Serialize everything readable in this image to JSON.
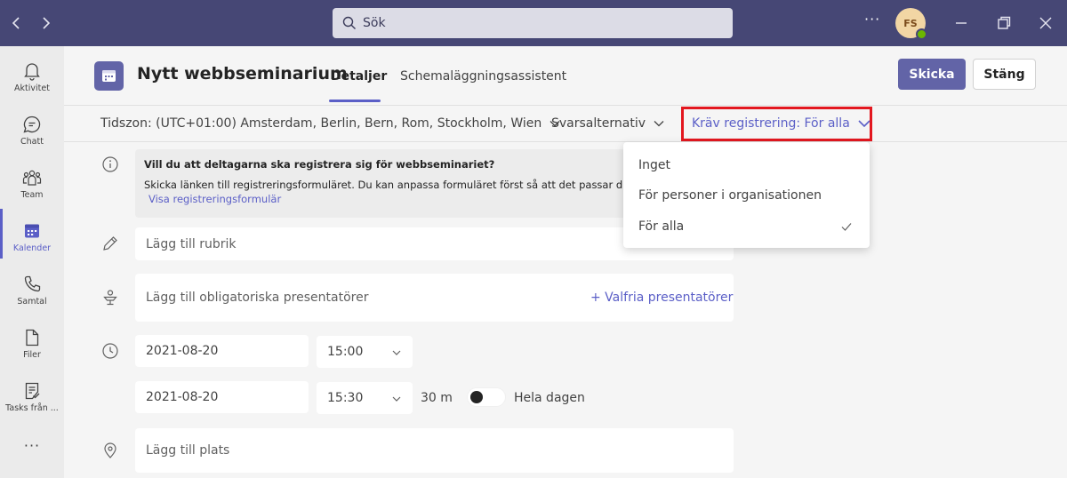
{
  "titlebar": {
    "search_placeholder": "Sök",
    "more_label": "···",
    "avatar_initials": "FS",
    "presence_color": "#6bb700",
    "bg_color": "#464775"
  },
  "rail": {
    "items": [
      {
        "label": "Aktivitet",
        "icon": "bell-icon"
      },
      {
        "label": "Chatt",
        "icon": "chat-icon"
      },
      {
        "label": "Team",
        "icon": "team-icon"
      },
      {
        "label": "Kalender",
        "icon": "calendar-icon",
        "active": true
      },
      {
        "label": "Samtal",
        "icon": "phone-icon"
      },
      {
        "label": "Filer",
        "icon": "file-icon"
      },
      {
        "label": "Tasks från ...",
        "icon": "tasks-icon"
      }
    ],
    "more_label": "···"
  },
  "header": {
    "title": "Nytt webbseminarium",
    "tabs": [
      {
        "label": "Detaljer",
        "active": true
      },
      {
        "label": "Schemaläggningsassistent",
        "active": false
      }
    ],
    "send_label": "Skicka",
    "close_label": "Stäng",
    "accent_color": "#6264a7"
  },
  "options": {
    "timezone": "Tidszon: (UTC+01:00) Amsterdam, Berlin, Bern, Rom, Stockholm, Wien",
    "response": "Svarsalternativ",
    "registration": "Kräv registrering: För alla"
  },
  "info": {
    "title": "Vill du att deltagarna ska registrera sig för webbseminariet?",
    "body": "Skicka länken till registreringsformuläret. Du kan anpassa formuläret först så att det passar ditt",
    "link": "Visa registreringsformulär"
  },
  "form": {
    "title_placeholder": "Lägg till rubrik",
    "presenters_placeholder": "Lägg till obligatoriska presentatörer",
    "optional_presenters": "+ Valfria presentatörer",
    "start_date": "2021-08-20",
    "start_time": "15:00",
    "end_date": "2021-08-20",
    "end_time": "15:30",
    "duration": "30 m",
    "all_day_label": "Hela dagen",
    "all_day_on": false,
    "location_placeholder": "Lägg till plats"
  },
  "dropdown": {
    "items": [
      {
        "label": "Inget",
        "selected": false
      },
      {
        "label": "För personer i organisationen",
        "selected": false
      },
      {
        "label": "För alla",
        "selected": true
      }
    ],
    "highlight_color": "#e3171f"
  }
}
